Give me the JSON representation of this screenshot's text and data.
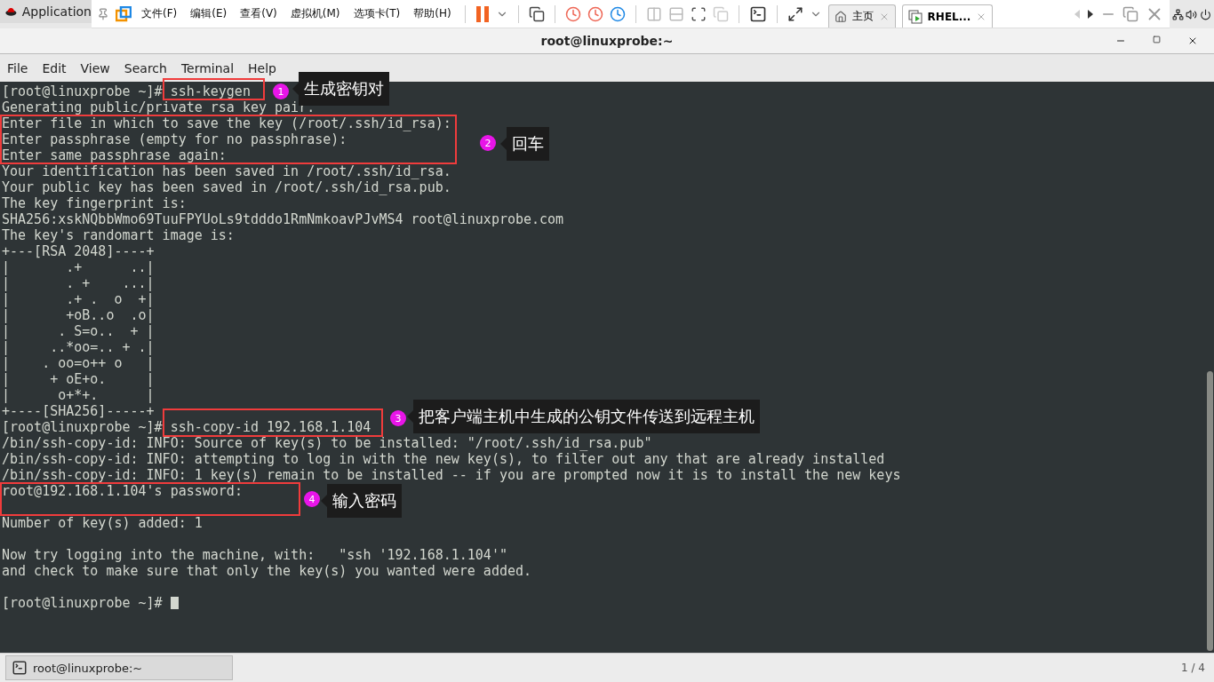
{
  "top_bar": {
    "applications": "Application"
  },
  "vm_toolbar": {
    "menus": [
      "文件(F)",
      "编辑(E)",
      "查看(V)",
      "虚拟机(M)",
      "选项卡(T)",
      "帮助(H)"
    ],
    "tabs": [
      {
        "kind": "home",
        "label": "主页",
        "selected": false
      },
      {
        "kind": "vm",
        "label": "RHEL...",
        "selected": true
      }
    ]
  },
  "window": {
    "title": "root@linuxprobe:~"
  },
  "menu": [
    "File",
    "Edit",
    "View",
    "Search",
    "Terminal",
    "Help"
  ],
  "terminal": {
    "lines": [
      {
        "kind": "prompt",
        "prompt": "[root@linuxprobe ~]#",
        "command": "ssh-keygen"
      },
      {
        "kind": "text",
        "text": "Generating public/private rsa key pair."
      },
      {
        "kind": "text",
        "text": "Enter file in which to save the key (/root/.ssh/id_rsa):"
      },
      {
        "kind": "text",
        "text": "Enter passphrase (empty for no passphrase):"
      },
      {
        "kind": "text",
        "text": "Enter same passphrase again:"
      },
      {
        "kind": "text",
        "text": "Your identification has been saved in /root/.ssh/id_rsa."
      },
      {
        "kind": "text",
        "text": "Your public key has been saved in /root/.ssh/id_rsa.pub."
      },
      {
        "kind": "text",
        "text": "The key fingerprint is:"
      },
      {
        "kind": "text",
        "text": "SHA256:xskNQbbWmo69TuuFPYUoLs9tdddo1RmNmkoavPJvMS4 root@linuxprobe.com"
      },
      {
        "kind": "text",
        "text": "The key's randomart image is:"
      },
      {
        "kind": "text",
        "text": "+---[RSA 2048]----+"
      },
      {
        "kind": "text",
        "text": "|       .+      ..|"
      },
      {
        "kind": "text",
        "text": "|       . +    ...|"
      },
      {
        "kind": "text",
        "text": "|       .+ .  o  +|"
      },
      {
        "kind": "text",
        "text": "|       +oB..o  .o|"
      },
      {
        "kind": "text",
        "text": "|      . S=o..  + |"
      },
      {
        "kind": "text",
        "text": "|     ..*oo=.. + .|"
      },
      {
        "kind": "text",
        "text": "|    . oo=o++ o   |"
      },
      {
        "kind": "text",
        "text": "|     + oE+o.     |"
      },
      {
        "kind": "text",
        "text": "|      o+*+.      |"
      },
      {
        "kind": "text",
        "text": "+----[SHA256]-----+"
      },
      {
        "kind": "prompt",
        "prompt": "[root@linuxprobe ~]#",
        "command": "ssh-copy-id 192.168.1.104"
      },
      {
        "kind": "text",
        "text": "/bin/ssh-copy-id: INFO: Source of key(s) to be installed: \"/root/.ssh/id_rsa.pub\""
      },
      {
        "kind": "text",
        "text": "/bin/ssh-copy-id: INFO: attempting to log in with the new key(s), to filter out any that are already installed"
      },
      {
        "kind": "text",
        "text": "/bin/ssh-copy-id: INFO: 1 key(s) remain to be installed -- if you are prompted now it is to install the new keys"
      },
      {
        "kind": "text",
        "text": "root@192.168.1.104's password:"
      },
      {
        "kind": "blank"
      },
      {
        "kind": "text",
        "text": "Number of key(s) added: 1"
      },
      {
        "kind": "blank"
      },
      {
        "kind": "text",
        "text": "Now try logging into the machine, with:   \"ssh '192.168.1.104'\""
      },
      {
        "kind": "text",
        "text": "and check to make sure that only the key(s) you wanted were added."
      },
      {
        "kind": "blank"
      },
      {
        "kind": "prompt",
        "prompt": "[root@linuxprobe ~]#",
        "cursor": true
      }
    ]
  },
  "annotations": [
    {
      "number": "1",
      "text": "生成密钥对"
    },
    {
      "number": "2",
      "text": "回车"
    },
    {
      "number": "3",
      "text": "把客户端主机中生成的公钥文件传送到远程主机"
    },
    {
      "number": "4",
      "text": "输入密码"
    }
  ],
  "taskbar": {
    "task": "root@linuxprobe:~",
    "pager": "1 / 4"
  }
}
